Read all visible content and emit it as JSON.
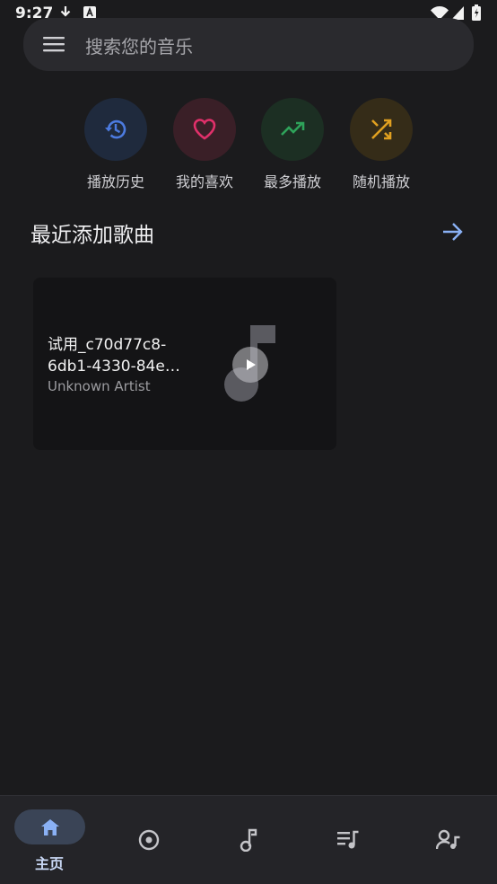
{
  "status_bar": {
    "time": "9:27"
  },
  "search": {
    "placeholder": "搜索您的音乐"
  },
  "quick_actions": [
    {
      "label": "播放历史",
      "icon": "history-icon",
      "color": "#4c7be0",
      "bg": "#1f2a3d"
    },
    {
      "label": "我的喜欢",
      "icon": "heart-icon",
      "color": "#e0306a",
      "bg": "#3a1f27"
    },
    {
      "label": "最多播放",
      "icon": "trending-up-icon",
      "color": "#2ea35a",
      "bg": "#1c2f23"
    },
    {
      "label": "随机播放",
      "icon": "shuffle-icon",
      "color": "#e0a020",
      "bg": "#352c18"
    }
  ],
  "recent": {
    "title": "最近添加歌曲",
    "songs": [
      {
        "title": "试用_c70d77c8-6db1-4330-84e…",
        "artist": "Unknown Artist"
      }
    ]
  },
  "bottom_nav": [
    {
      "label": "主页",
      "icon": "home-icon",
      "active": true
    },
    {
      "label": "",
      "icon": "album-icon"
    },
    {
      "label": "",
      "icon": "music-note-icon"
    },
    {
      "label": "",
      "icon": "playlist-icon"
    },
    {
      "label": "",
      "icon": "artist-icon"
    }
  ]
}
